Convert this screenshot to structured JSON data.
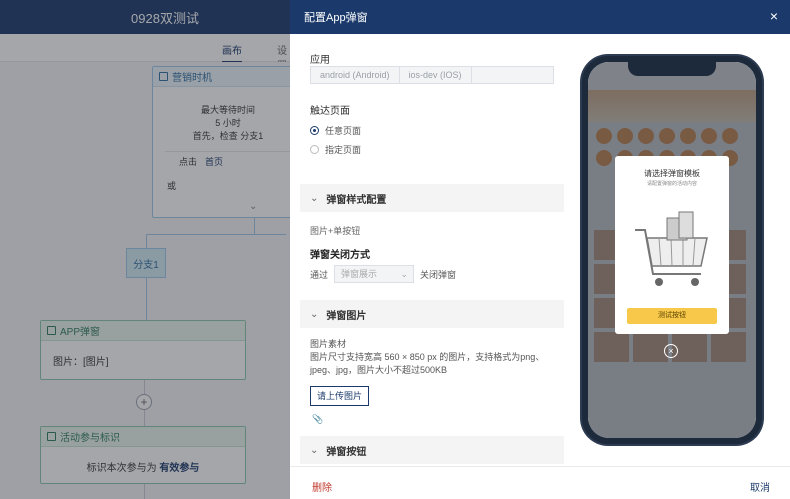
{
  "left": {
    "header_title": "0928双测试",
    "tabs": [
      "画布",
      "设置"
    ],
    "trigger_node": {
      "title": "营销时机",
      "lines": [
        "最大等待时间",
        "5 小时",
        "首先，检查 分支1"
      ],
      "event_label": "点击",
      "event_page": "首页",
      "or_label": "或"
    },
    "branch_label": "分支1",
    "popup_node": {
      "title": "APP弹窗",
      "body": "图片：[图片]"
    },
    "plus_label": "+",
    "activity_node": {
      "title": "活动参与标识",
      "body_prefix": "标识本次参与为",
      "body_value": "有效参与"
    }
  },
  "drawer": {
    "title": "配置App弹窗",
    "close_icon": "×",
    "app_label": "应用",
    "app_options": [
      "android (Android)",
      "ios-dev (IOS)"
    ],
    "trigger_page_label": "触达页面",
    "radio_any": "任意页面",
    "radio_specific": "指定页面",
    "section_style": "弹窗样式配置",
    "style_value": "图片+单按钮",
    "close_mode_label": "弹窗关闭方式",
    "close_mode_prefix": "通过",
    "close_mode_select": "弹窗展示",
    "close_mode_suffix": "关闭弹窗",
    "section_image": "弹窗图片",
    "image_material": "图片素材",
    "image_hint": "图片尺寸支持宽高 560 × 850 px 的图片，支持格式为png、jpeg、jpg，图片大小不超过500KB",
    "upload_button": "请上传图片",
    "section_button": "弹窗按钮",
    "delete_button": "删除",
    "cancel_button": "取消"
  },
  "preview": {
    "modal_title": "请选择弹窗模板",
    "modal_subtitle": "请配置弹窗的活动内容",
    "modal_button": "测试按钮",
    "close_icon": "×"
  },
  "colors": {
    "brand": "#1b3a6b",
    "node_border": "#8bc7ad",
    "accent_yellow": "#f7c84a",
    "danger": "#c0392b"
  }
}
